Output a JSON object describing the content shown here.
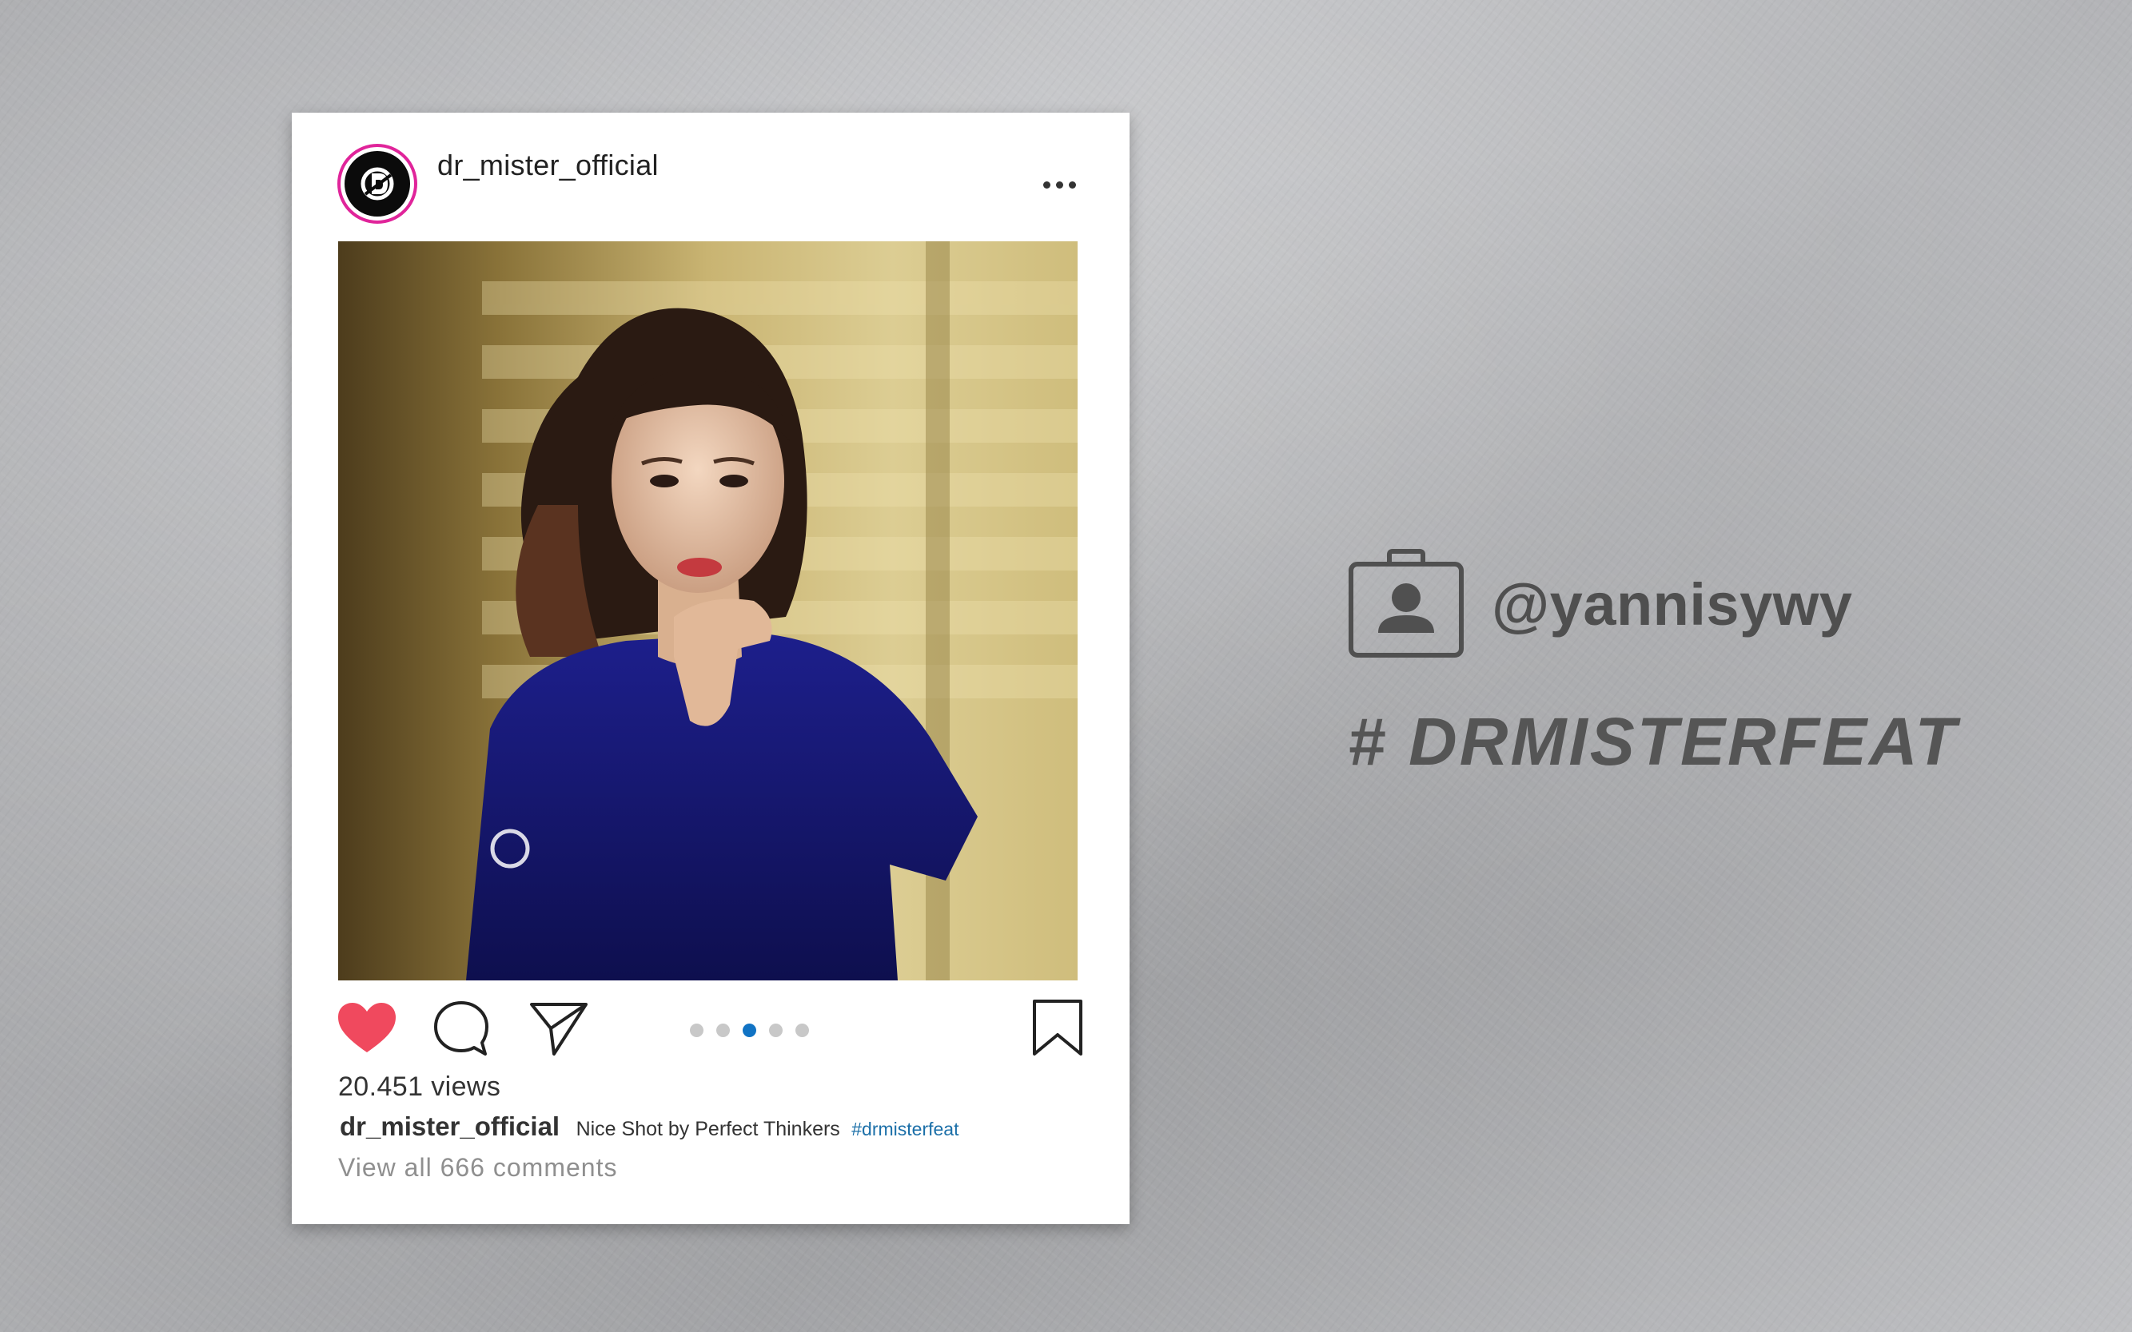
{
  "post": {
    "username": "dr_mister_official",
    "views": "20.451 views",
    "caption_user": "dr_mister_official",
    "caption_text": "Nice Shot by Perfect Thinkers",
    "caption_hashtag": "#drmisterfeat",
    "view_comments": "View all 666 comments",
    "carousel": {
      "total": 5,
      "active_index": 2
    },
    "liked": true,
    "like_color": "#f0495e",
    "carousel_active_color": "#1173c4",
    "avatar_ring_color": "#e0249a"
  },
  "credit": {
    "handle": "@yannisywy",
    "hashtag": "# DRMISTERFEAT",
    "icon": "id-badge-icon"
  }
}
